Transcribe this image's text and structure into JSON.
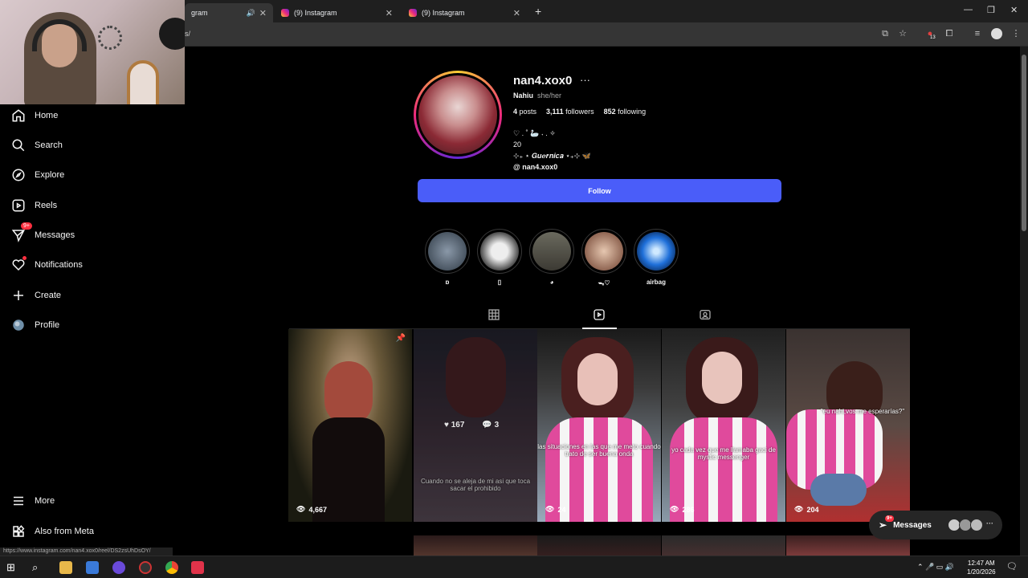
{
  "browser": {
    "tabs": [
      {
        "label": "gram"
      },
      {
        "label": "(9) Instagram"
      },
      {
        "label": "(9) Instagram"
      }
    ],
    "url_fragment": "s/",
    "extension_badge": "13"
  },
  "sidebar": {
    "items": [
      {
        "label": "Home"
      },
      {
        "label": "Search"
      },
      {
        "label": "Explore"
      },
      {
        "label": "Reels"
      },
      {
        "label": "Messages",
        "badge": "9+"
      },
      {
        "label": "Notifications"
      },
      {
        "label": "Create"
      },
      {
        "label": "Profile"
      }
    ],
    "more": "More",
    "meta": "Also from Meta"
  },
  "status_url": "https://www.instagram.com/nan4.xox0/reel/DS2zsUhDsOY/",
  "profile": {
    "username": "nan4.xox0",
    "more": "···",
    "full_name": "Nahiu",
    "pronouns": "she/her",
    "posts_count": "4",
    "posts_label": "posts",
    "followers_count": "3,111",
    "followers_label": "followers",
    "following_count": "852",
    "following_label": "following",
    "bio_lines": [
      "♡ . ˚ 🦢 ˖ . ✧",
      "20",
      "⊹₊ ⋆ 𝑮𝒖𝒆𝒓𝒏𝒊𝒄𝒂 ⋆₊⊹ 🦋"
    ],
    "threads_handle": "nan4.xox0",
    "follow_label": "Follow"
  },
  "highlights": [
    {
      "label": "ɒ"
    },
    {
      "label": "▯"
    },
    {
      "label": "◕"
    },
    {
      "label": "ᯓ♡"
    },
    {
      "label": "airbag"
    }
  ],
  "reels": [
    {
      "views": "4,667",
      "caption": ""
    },
    {
      "likes": "167",
      "comments": "3",
      "caption": "Cuando no se aleja de mi asi que toca sacar el prohibido"
    },
    {
      "views": "24",
      "caption": "las situaciones en las que me meto cuando trato de ser buena onda"
    },
    {
      "views": "286",
      "caption": "yo cada vez que me llamaba gaci de mystic messenger"
    },
    {
      "views": "204",
      "caption": "\"eu nahi,vos me esperarías?\""
    }
  ],
  "messages_bar": {
    "label": "Messages",
    "badge": "9+",
    "more": "···"
  },
  "taskbar": {
    "time": "12:47 AM",
    "date": "1/20/2026"
  }
}
